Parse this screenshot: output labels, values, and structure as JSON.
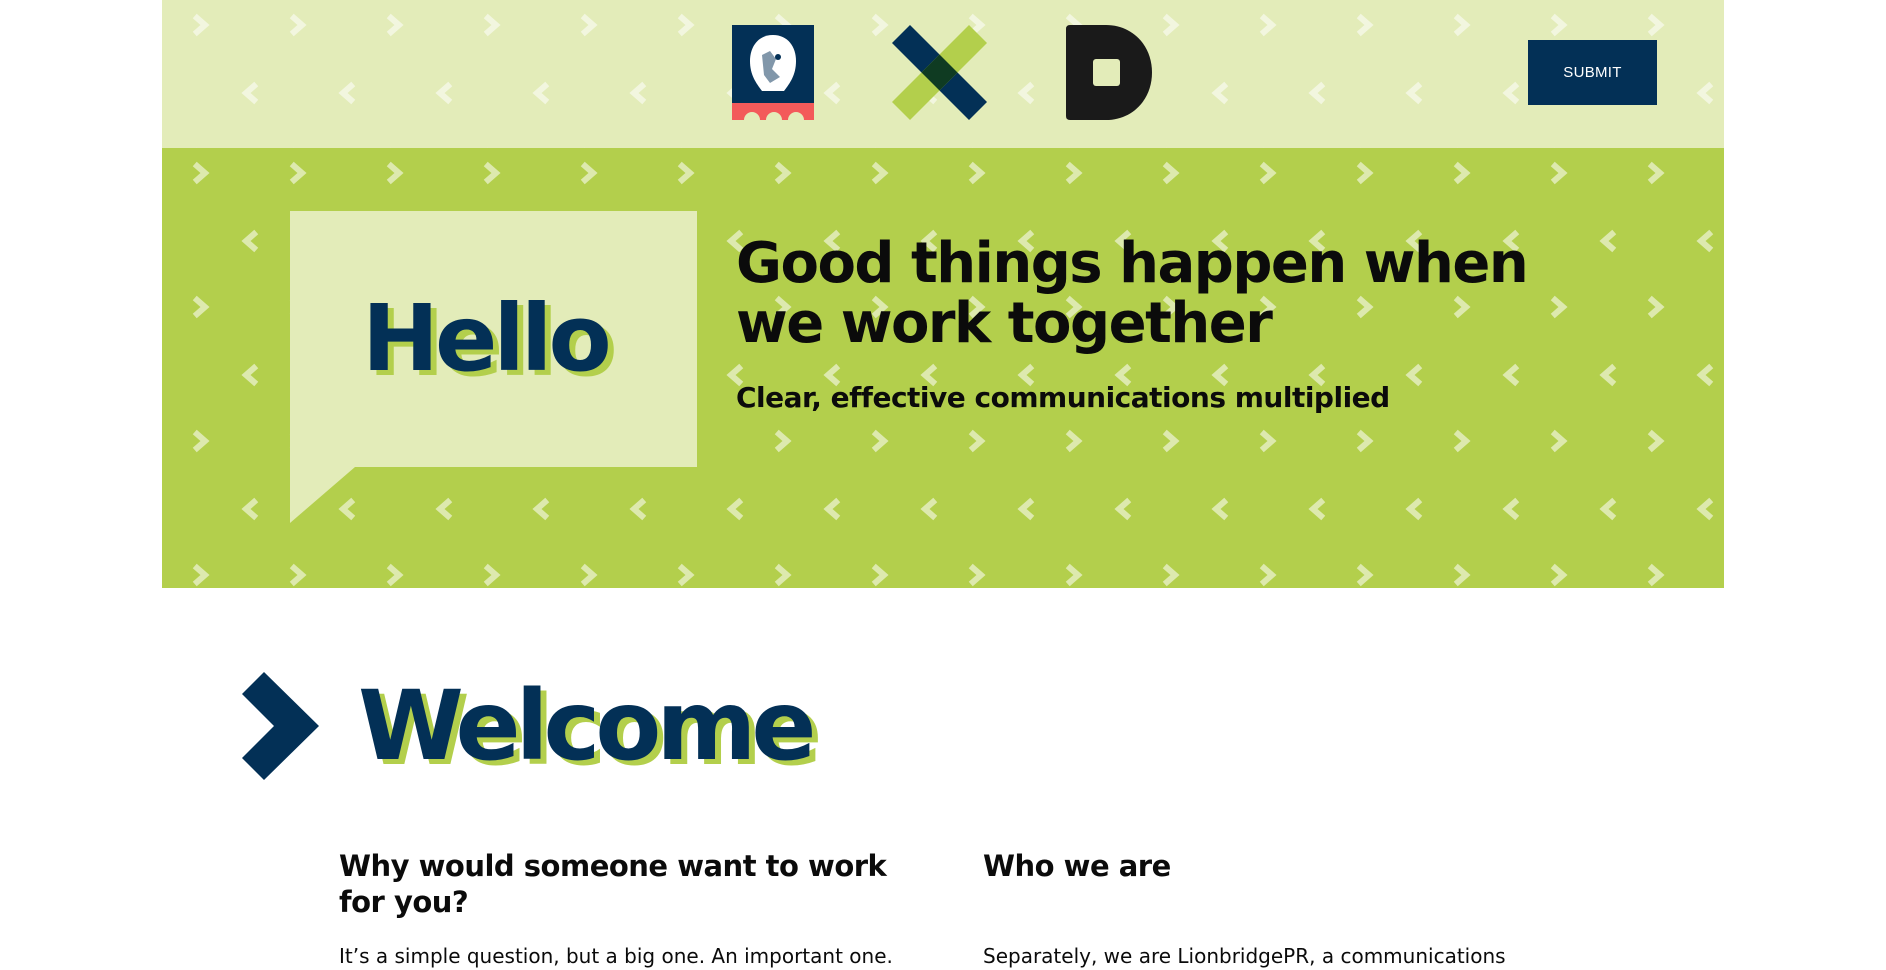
{
  "header": {
    "logos": [
      {
        "icon": "lion-shield-logo-icon"
      },
      {
        "icon": "x-cross-logo-icon"
      },
      {
        "icon": "d-letter-logo-icon"
      }
    ],
    "submit_label": "SUBMIT"
  },
  "hero": {
    "bubble_text": "Hello",
    "title": "Good things happen when we work together",
    "subtitle": "Clear, effective communications multiplied"
  },
  "welcome": {
    "title": "Welcome",
    "icon": "chevron-right-icon"
  },
  "columns": [
    {
      "heading": "Why would someone want to work for you?",
      "text": "It’s a simple question, but a big one. An important one."
    },
    {
      "heading": "Who we are",
      "text": "Separately, we are LionbridgePR, a communications"
    }
  ],
  "colors": {
    "navy": "#033056",
    "lime": "#b3cf4c",
    "pale_lime": "#e3ecb9",
    "black": "#0b0b0b",
    "coral": "#f35a5a"
  }
}
